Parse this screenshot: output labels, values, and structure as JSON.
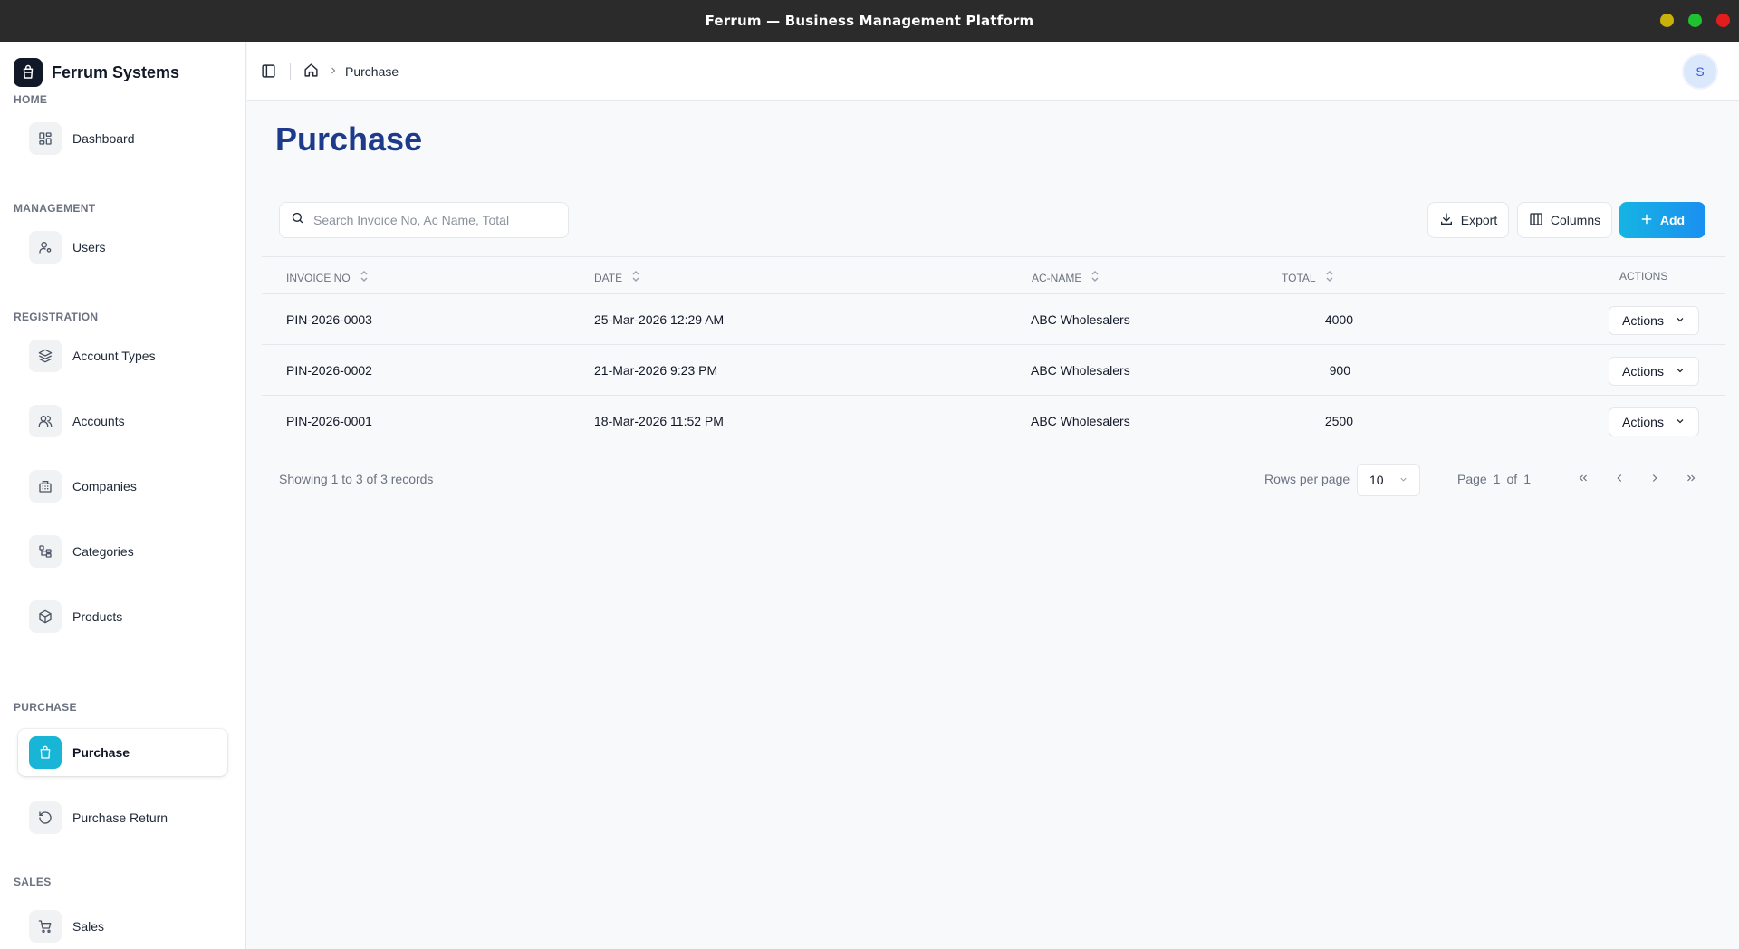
{
  "window": {
    "title": "Ferrum — Business Management Platform",
    "buttons": {
      "minimize_color": "#c9b10b",
      "maximize_color": "#1ec12f",
      "close_color": "#e11d1d"
    }
  },
  "sidebar": {
    "brand": "Ferrum Systems",
    "sections": {
      "home": "HOME",
      "management": "MANAGEMENT",
      "registration": "REGISTRATION",
      "purchase": "PURCHASE",
      "sales": "SALES"
    },
    "items": {
      "dashboard": "Dashboard",
      "users": "Users",
      "account_types": "Account Types",
      "accounts": "Accounts",
      "companies": "Companies",
      "categories": "Categories",
      "products": "Products",
      "purchase": "Purchase",
      "purchase_return": "Purchase Return",
      "sales": "Sales"
    },
    "active_item": "purchase",
    "accent_color": "#19b5d6"
  },
  "topbar": {
    "breadcrumb_current": "Purchase",
    "avatar_initial": "S"
  },
  "page": {
    "title": "Purchase",
    "title_color": "#1e3a8a"
  },
  "toolbar": {
    "search_placeholder": "Search Invoice No, Ac Name, Total",
    "search_value": "",
    "export_label": "Export",
    "columns_label": "Columns",
    "add_label": "Add"
  },
  "table": {
    "headers": {
      "invoice_no": "INVOICE NO",
      "date": "DATE",
      "ac_name": "AC-NAME",
      "total": "TOTAL",
      "actions": "ACTIONS"
    },
    "rows": [
      {
        "invoice_no": "PIN-2026-0003",
        "date": "25-Mar-2026 12:29 AM",
        "ac_name": "ABC Wholesalers",
        "total": "4000",
        "action": "Actions"
      },
      {
        "invoice_no": "PIN-2026-0002",
        "date": "21-Mar-2026 9:23 PM",
        "ac_name": "ABC Wholesalers",
        "total": "900",
        "action": "Actions"
      },
      {
        "invoice_no": "PIN-2026-0001",
        "date": "18-Mar-2026 11:52 PM",
        "ac_name": "ABC Wholesalers",
        "total": "2500",
        "action": "Actions"
      }
    ]
  },
  "pagination": {
    "summary": "Showing 1 to 3 of 3 records",
    "rows_per_page_label": "Rows per page",
    "rows_per_page_value": "10",
    "page_label": "Page",
    "current_page": "1",
    "of_label": "of",
    "total_pages": "1"
  },
  "icons": {
    "brand": "package-icon",
    "dashboard": "grid-icon",
    "users": "user-cog-icon",
    "account_types": "layers-icon",
    "accounts": "users-icon",
    "companies": "building-icon",
    "categories": "tree-icon",
    "products": "box-icon",
    "purchase": "shopping-bag-icon",
    "purchase_return": "rotate-ccw-icon",
    "sales": "shopping-cart-icon"
  }
}
